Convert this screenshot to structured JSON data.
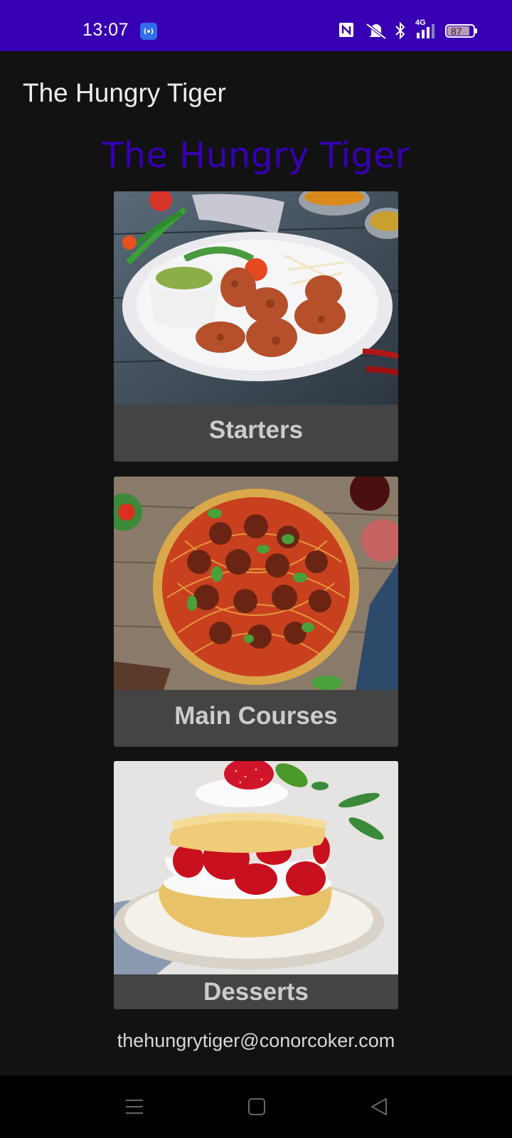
{
  "status_bar": {
    "time": "13:07",
    "battery_level": "87",
    "network_type": "4G",
    "icons": [
      "hotspot-icon",
      "nfc-icon",
      "mute-icon",
      "bluetooth-icon",
      "signal-icon",
      "battery-icon"
    ],
    "background_color": "#3700b3"
  },
  "app_bar": {
    "title": "The Hungry Tiger"
  },
  "main": {
    "hero_title": "The Hungry Tiger",
    "hero_color": "#3700b3",
    "categories": [
      {
        "label": "Starters",
        "image": "grilled chicken tikka with mint chutney on a white plate"
      },
      {
        "label": "Main Courses",
        "image": "spaghetti and meatballs with basil"
      },
      {
        "label": "Desserts",
        "image": "strawberry shortcake with cream"
      }
    ],
    "email": "thehungrytiger@conorcoker.com"
  },
  "nav_bar": {
    "icons": [
      "menu-icon",
      "home-icon",
      "back-icon"
    ]
  }
}
